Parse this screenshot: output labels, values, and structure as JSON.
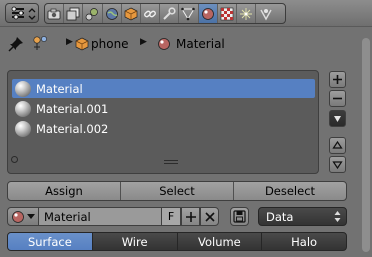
{
  "header": {
    "editor_type_icon": "properties-editor-icon",
    "tabs": [
      {
        "name": "render",
        "icon": "camera-icon",
        "active": false
      },
      {
        "name": "render-layers",
        "icon": "layers-icon",
        "active": false
      },
      {
        "name": "scene",
        "icon": "scene-icon",
        "active": false
      },
      {
        "name": "world",
        "icon": "world-icon",
        "active": false
      },
      {
        "name": "object",
        "icon": "object-cube-icon",
        "active": false
      },
      {
        "name": "constraints",
        "icon": "constraint-link-icon",
        "active": false
      },
      {
        "name": "modifiers",
        "icon": "wrench-icon",
        "active": false
      },
      {
        "name": "data",
        "icon": "mesh-data-icon",
        "active": false
      },
      {
        "name": "material",
        "icon": "material-sphere-icon",
        "active": true
      },
      {
        "name": "texture",
        "icon": "checker-texture-icon",
        "active": false
      },
      {
        "name": "particles",
        "icon": "particles-icon",
        "active": false
      },
      {
        "name": "physics",
        "icon": "physics-icon",
        "active": false
      }
    ]
  },
  "breadcrumb": {
    "object": "phone",
    "material": "Material"
  },
  "slots": [
    {
      "label": "Material",
      "selected": true
    },
    {
      "label": "Material.001",
      "selected": false
    },
    {
      "label": "Material.002",
      "selected": false
    }
  ],
  "slot_actions": {
    "assign": "Assign",
    "select": "Select",
    "deselect": "Deselect"
  },
  "material_block": {
    "name": "Material",
    "fake_user": "F",
    "link": "Data"
  },
  "type_tabs": [
    {
      "label": "Surface",
      "active": true
    },
    {
      "label": "Wire",
      "active": false
    },
    {
      "label": "Volume",
      "active": false
    },
    {
      "label": "Halo",
      "active": false
    }
  ],
  "colors": {
    "accent": "#5680c2",
    "panel_bg": "#727272"
  }
}
